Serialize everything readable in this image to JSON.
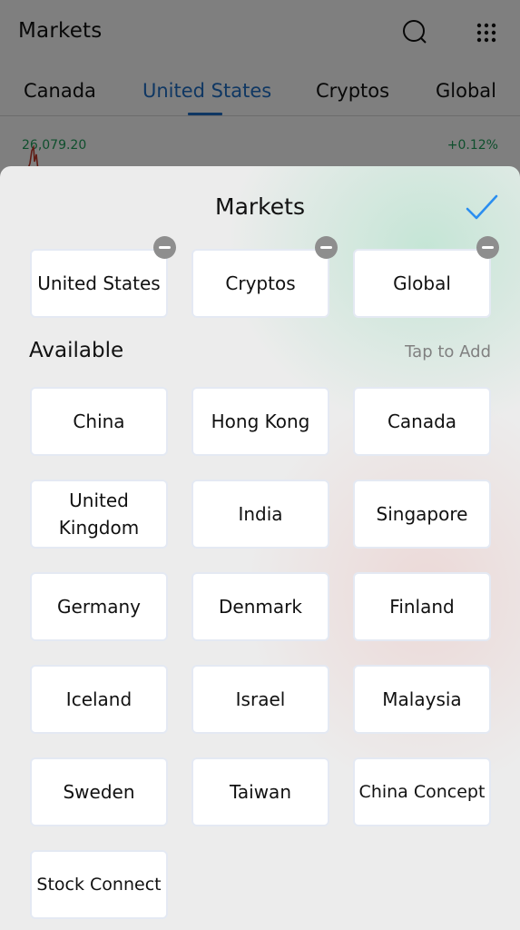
{
  "header": {
    "title": "Markets",
    "icons": [
      "search-icon",
      "apps-grid-icon"
    ]
  },
  "tabs": [
    {
      "label": "Canada",
      "active": false
    },
    {
      "label": "United States",
      "active": true
    },
    {
      "label": "Cryptos",
      "active": false
    },
    {
      "label": "Global",
      "active": false
    }
  ],
  "quote": {
    "value": "26,079.20",
    "change": "+0.12%"
  },
  "colors": {
    "accent": "#1f6fc6",
    "positive": "#1e9e5a",
    "check": "#2b8ef0",
    "remove_badge": "#8e8e8e"
  },
  "sheet": {
    "title": "Markets",
    "done_icon": "checkmark-icon",
    "selected": [
      {
        "label": "United States"
      },
      {
        "label": "Cryptos"
      },
      {
        "label": "Global"
      }
    ],
    "available_label": "Available",
    "available_hint": "Tap to Add",
    "available": [
      {
        "label": "China"
      },
      {
        "label": "Hong Kong"
      },
      {
        "label": "Canada"
      },
      {
        "label": "United\nKingdom"
      },
      {
        "label": "India"
      },
      {
        "label": "Singapore"
      },
      {
        "label": "Germany"
      },
      {
        "label": "Denmark"
      },
      {
        "label": "Finland"
      },
      {
        "label": "Iceland"
      },
      {
        "label": "Israel"
      },
      {
        "label": "Malaysia"
      },
      {
        "label": "Sweden"
      },
      {
        "label": "Taiwan"
      },
      {
        "label": "China Concept"
      },
      {
        "label": "Stock Connect"
      }
    ]
  }
}
